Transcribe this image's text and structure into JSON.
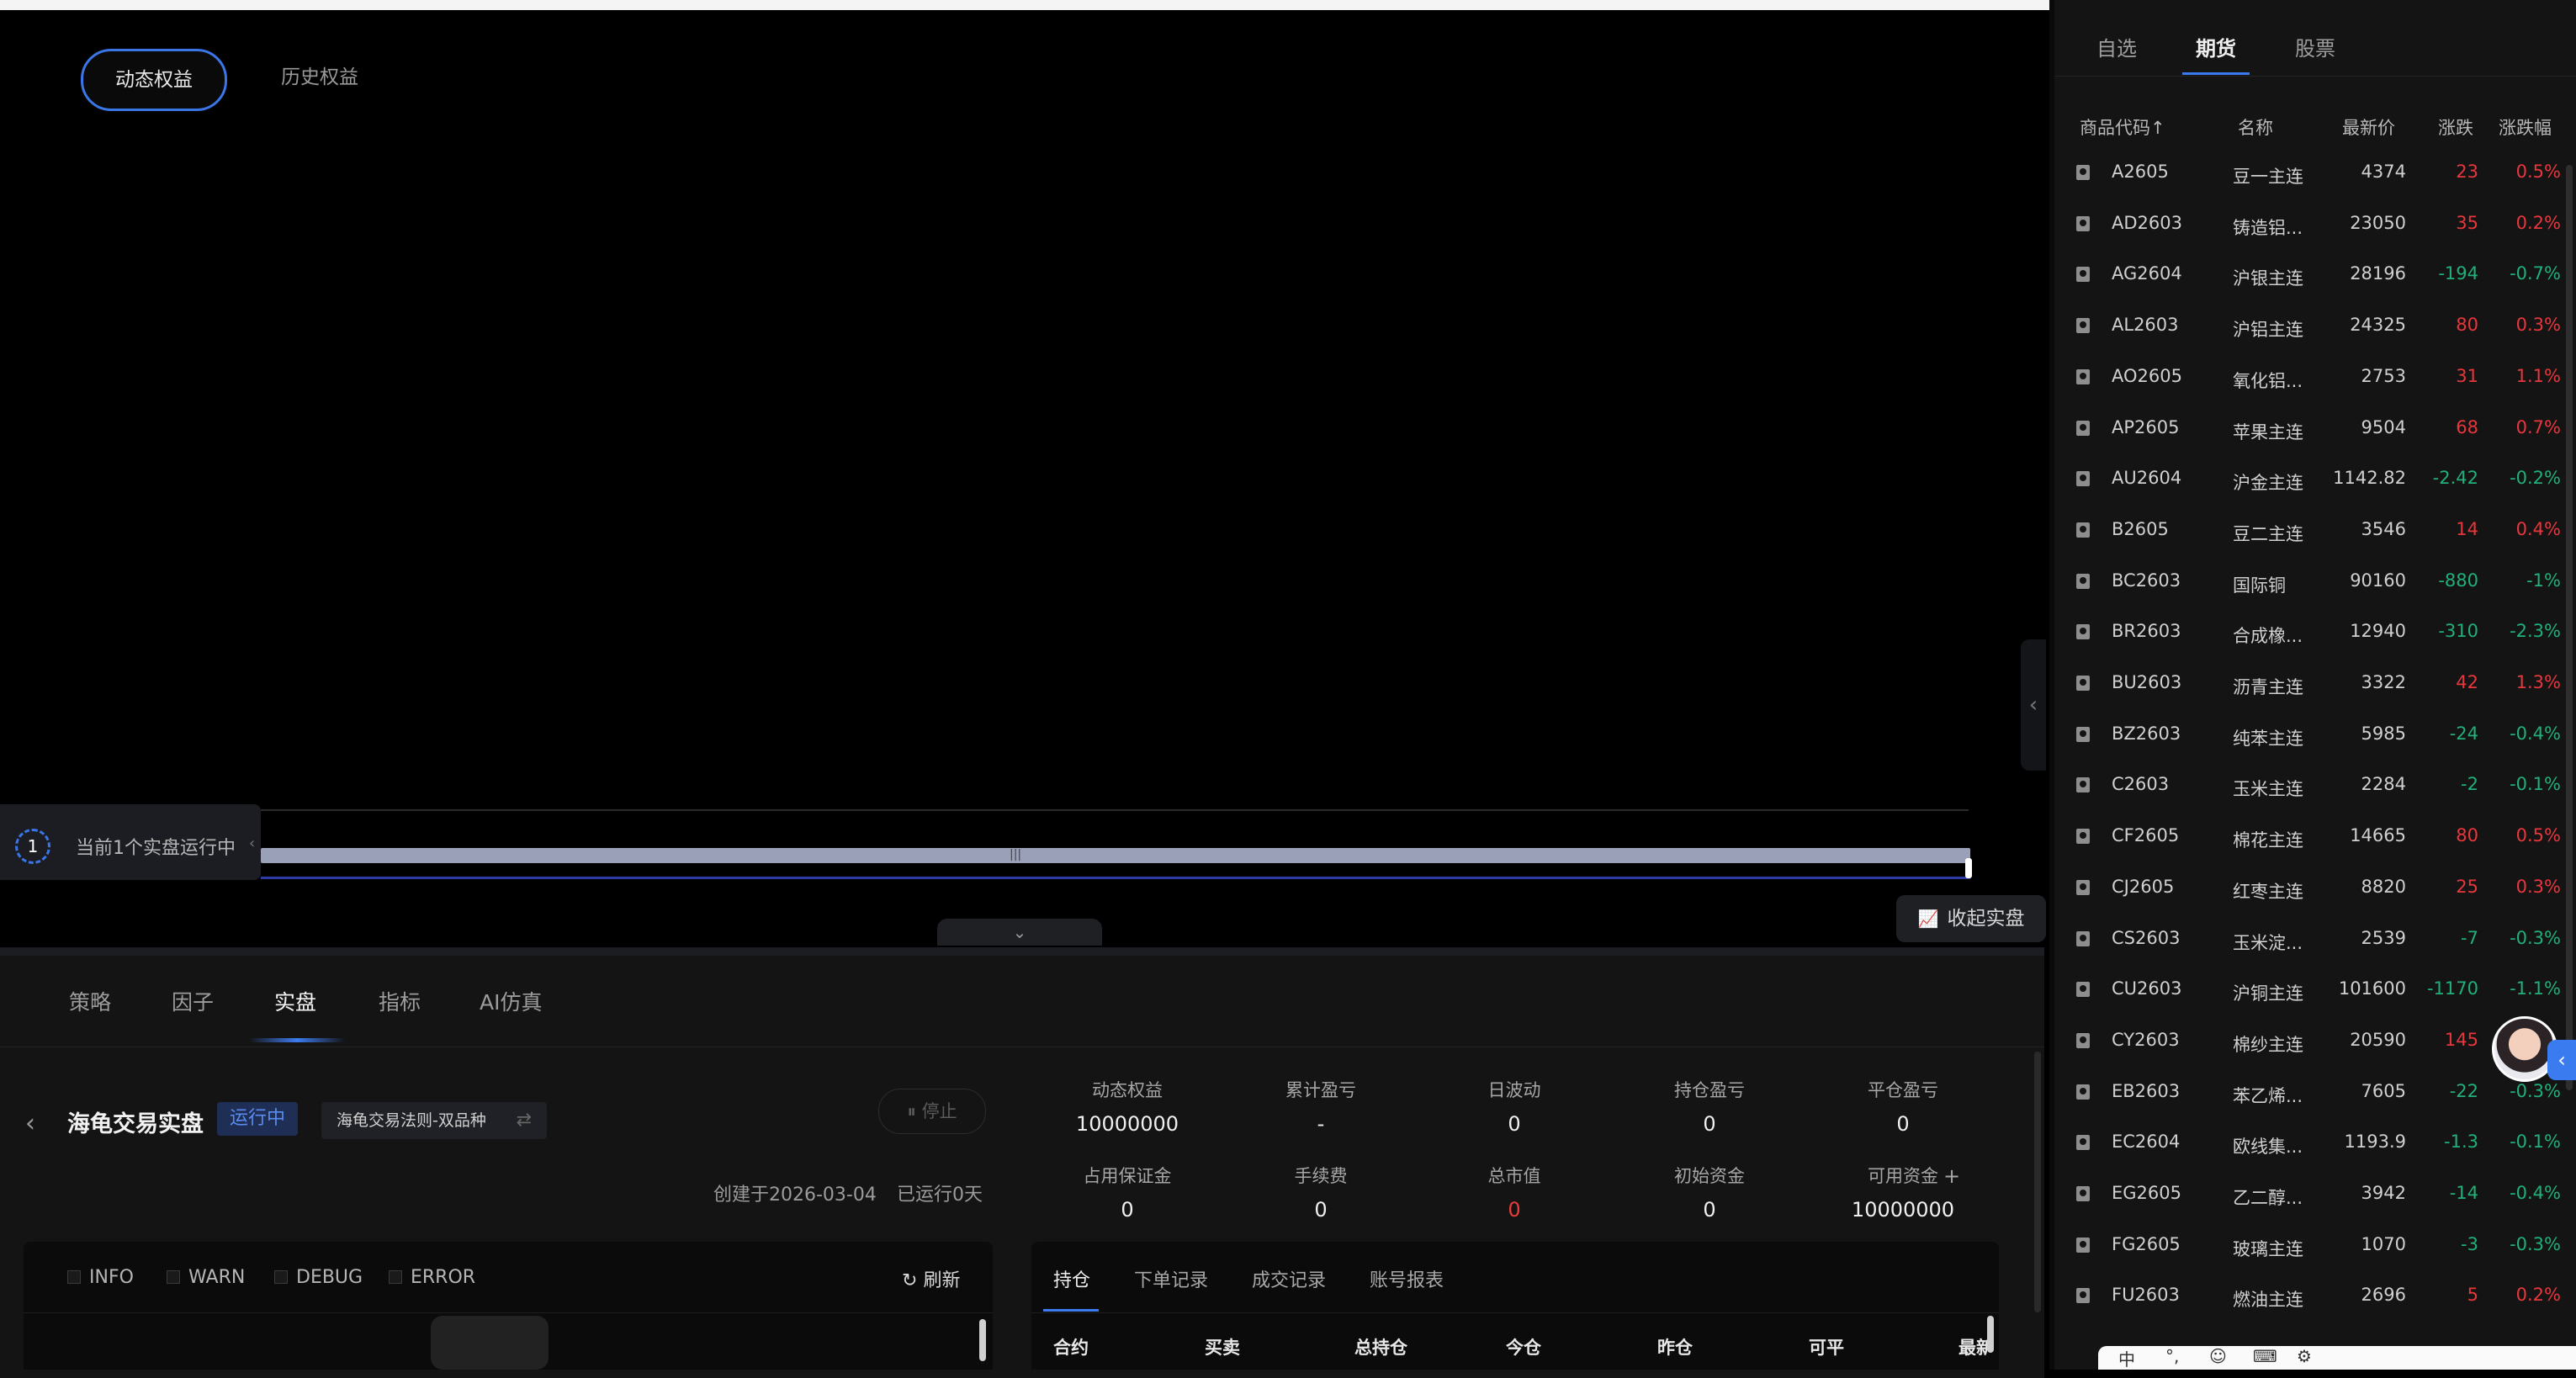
{
  "chart_tabs": {
    "dynamic": "动态权益",
    "history": "历史权益"
  },
  "running": {
    "count": "1",
    "text": "当前1个实盘运行中"
  },
  "collapse_label": "收起实盘",
  "main_tabs": [
    "策略",
    "因子",
    "实盘",
    "指标",
    "AI仿真"
  ],
  "strategy": {
    "name": "海龟交易实盘",
    "status": "运行中",
    "select": "海龟交易法则-双品种",
    "stop_label": "停止",
    "created": "创建于2026-03-04",
    "runtime": "已运行0天"
  },
  "stats": [
    {
      "label": "动态权益",
      "value": "10000000"
    },
    {
      "label": "累计盈亏",
      "value": "-"
    },
    {
      "label": "日波动",
      "value": "0"
    },
    {
      "label": "持仓盈亏",
      "value": "0"
    },
    {
      "label": "平仓盈亏",
      "value": "0"
    },
    {
      "label": "占用保证金",
      "value": "0"
    },
    {
      "label": "手续费",
      "value": "0"
    },
    {
      "label": "总市值",
      "value": "0"
    },
    {
      "label": "初始资金",
      "value": "0"
    },
    {
      "label": "可用资金",
      "value": "10000000"
    }
  ],
  "log": {
    "options": [
      "INFO",
      "WARN",
      "DEBUG",
      "ERROR"
    ],
    "refresh": "刷新"
  },
  "position": {
    "tabs": [
      "持仓",
      "下单记录",
      "成交记录",
      "账号报表"
    ],
    "columns": [
      "合约",
      "买卖",
      "总持仓",
      "今仓",
      "昨仓",
      "可平",
      "最新"
    ]
  },
  "watch": {
    "tabs": [
      "自选",
      "期货",
      "股票"
    ],
    "headers": [
      "商品代码↑",
      "名称",
      "最新价",
      "涨跌",
      "涨跌幅"
    ],
    "rows": [
      [
        "A2605",
        "豆一主连",
        "4374",
        "23",
        "0.5%"
      ],
      [
        "AD2603",
        "铸造铝...",
        "23050",
        "35",
        "0.2%"
      ],
      [
        "AG2604",
        "沪银主连",
        "28196",
        "-194",
        "-0.7%"
      ],
      [
        "AL2603",
        "沪铝主连",
        "24325",
        "80",
        "0.3%"
      ],
      [
        "AO2605",
        "氧化铝...",
        "2753",
        "31",
        "1.1%"
      ],
      [
        "AP2605",
        "苹果主连",
        "9504",
        "68",
        "0.7%"
      ],
      [
        "AU2604",
        "沪金主连",
        "1142.82",
        "-2.42",
        "-0.2%"
      ],
      [
        "B2605",
        "豆二主连",
        "3546",
        "14",
        "0.4%"
      ],
      [
        "BC2603",
        "国际铜",
        "90160",
        "-880",
        "-1%"
      ],
      [
        "BR2603",
        "合成橡...",
        "12940",
        "-310",
        "-2.3%"
      ],
      [
        "BU2603",
        "沥青主连",
        "3322",
        "42",
        "1.3%"
      ],
      [
        "BZ2603",
        "纯苯主连",
        "5985",
        "-24",
        "-0.4%"
      ],
      [
        "C2603",
        "玉米主连",
        "2284",
        "-2",
        "-0.1%"
      ],
      [
        "CF2605",
        "棉花主连",
        "14665",
        "80",
        "0.5%"
      ],
      [
        "CJ2605",
        "红枣主连",
        "8820",
        "25",
        "0.3%"
      ],
      [
        "CS2603",
        "玉米淀...",
        "2539",
        "-7",
        "-0.3%"
      ],
      [
        "CU2603",
        "沪铜主连",
        "101600",
        "-1170",
        "-1.1%"
      ],
      [
        "CY2603",
        "棉纱主连",
        "20590",
        "145",
        ""
      ],
      [
        "EB2603",
        "苯乙烯...",
        "7605",
        "-22",
        "-0.3%"
      ],
      [
        "EC2604",
        "欧线集...",
        "1193.9",
        "-1.3",
        "-0.1%"
      ],
      [
        "EG2605",
        "乙二醇...",
        "3942",
        "-14",
        "-0.4%"
      ],
      [
        "FG2605",
        "玻璃主连",
        "1070",
        "-3",
        "-0.3%"
      ],
      [
        "FU2603",
        "燃油主连",
        "2696",
        "5",
        "0.2%"
      ]
    ]
  },
  "ime": [
    "中",
    "°,",
    "☺",
    "⌨",
    "⚙"
  ]
}
